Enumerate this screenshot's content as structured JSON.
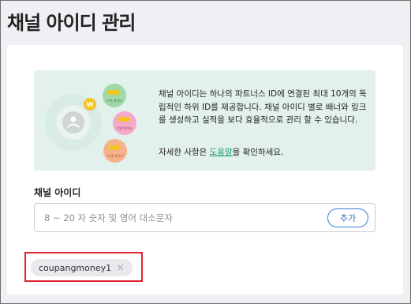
{
  "page": {
    "title": "채널 아이디 관리"
  },
  "banner": {
    "description": "채널 아이디는 하나의 파트너스 ID에 연결된 최대 10개의 독립적인 하위 ID를 제공합니다. 채널 아이디 별로 배너와 링크를 생성하고 실적을 보다 효율적으로 관리 할 수 있습니다.",
    "help_prefix": "자세한 사항은 ",
    "help_link": "도움말",
    "help_suffix": "을 확인하세요.",
    "illustration": {
      "coin_label": "W",
      "bubble_label_1": "브랜 데이터",
      "bubble_label_2": "브랜 데이터",
      "bubble_label_3": "브랜 데이터",
      "bubble_colors": [
        "#9fd9a8",
        "#f4a9c8",
        "#f6b28c"
      ]
    }
  },
  "channel": {
    "label": "채널 아이디",
    "placeholder": "8 ~ 20 자 숫자 및 영어 대소문자",
    "add_label": "추가",
    "chips": [
      {
        "label": "coupangmoney1",
        "remove_icon": "×"
      }
    ]
  },
  "colors": {
    "accent": "#3a7bd5",
    "highlight_box": "#e0232e",
    "banner_bg": "#e3f1ed",
    "link": "#1e9d6c"
  }
}
